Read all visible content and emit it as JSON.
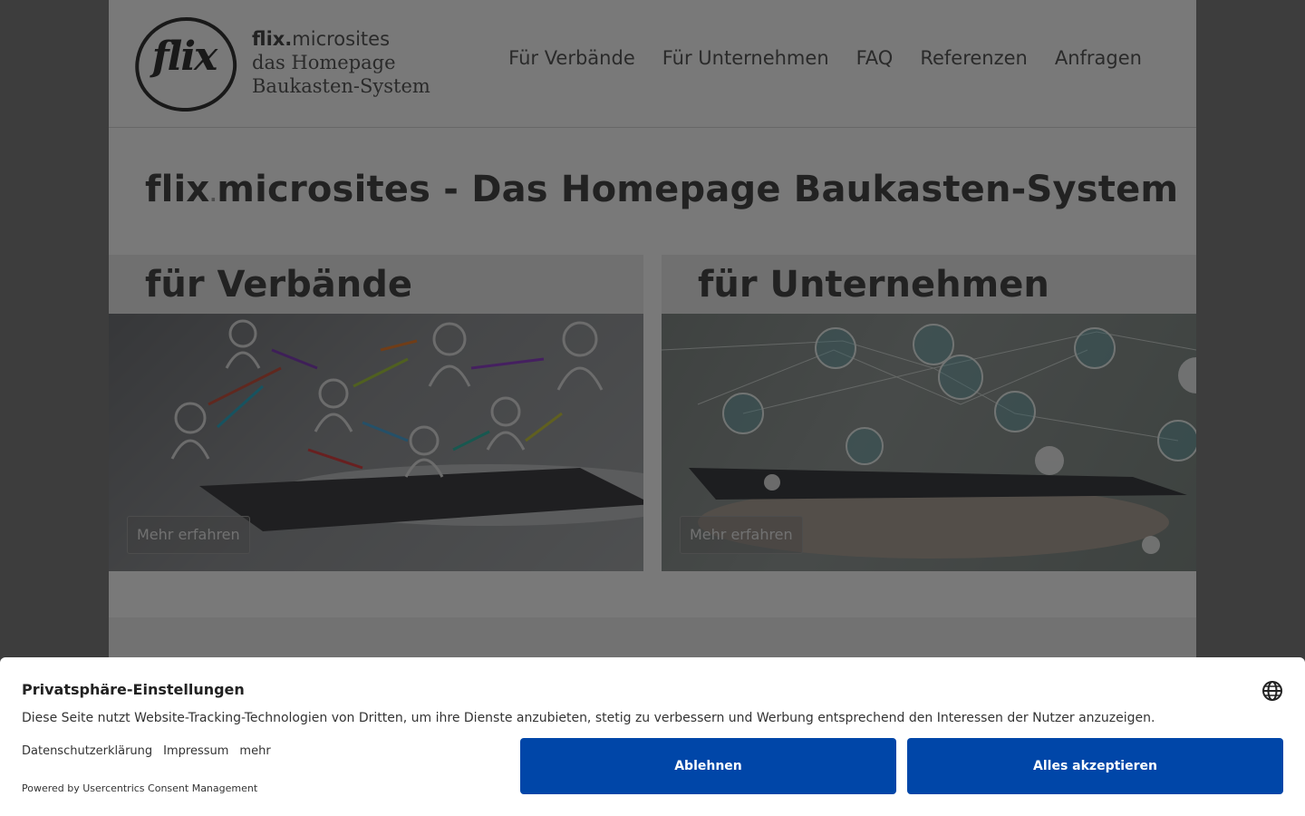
{
  "header": {
    "logo_mark": "flix",
    "logo_line1_brand": "flix.",
    "logo_line1_rest": "microsites",
    "logo_line2": "das Homepage",
    "logo_line3": "Baukasten-System",
    "nav": [
      "Für Verbände",
      "Für Unternehmen",
      "FAQ",
      "Referenzen",
      "Anfragen"
    ]
  },
  "main": {
    "title_brand": "flix",
    "title_dot": ".",
    "title_rest": "microsites - Das Homepage Baukasten-System",
    "cards": [
      {
        "title": "für Verbände",
        "button": "Mehr erfahren"
      },
      {
        "title": "für Unternehmen",
        "button": "Mehr erfahren"
      }
    ]
  },
  "consent": {
    "title": "Privatsphäre-Einstellungen",
    "description": "Diese Seite nutzt Website-Tracking-Technologien von Dritten, um ihre Dienste anzubieten, stetig zu verbessern und Werbung entsprechend den Interessen der Nutzer anzuzeigen.",
    "links": [
      "Datenschutzerklärung",
      "Impressum",
      "mehr"
    ],
    "powered_by": "Powered by Usercentrics Consent Management",
    "reject_label": "Ablehnen",
    "accept_label": "Alles akzeptieren",
    "button_color": "#0046a8",
    "language_icon": "globe-icon"
  }
}
